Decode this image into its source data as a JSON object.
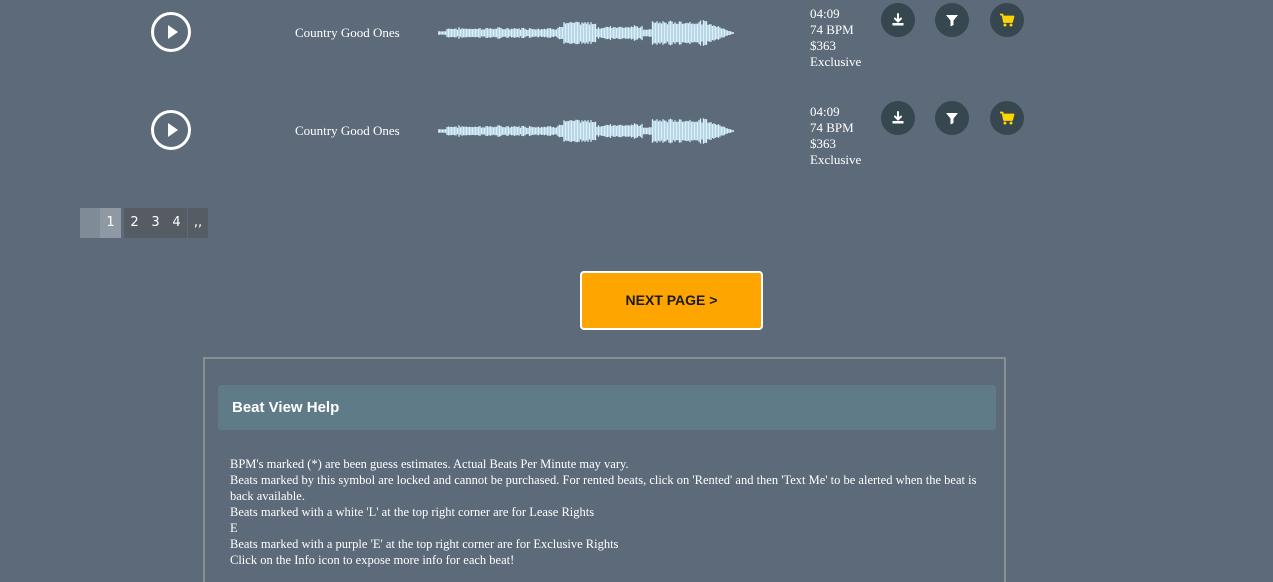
{
  "beats": [
    {
      "title": "Country Good Ones",
      "duration": "04:09",
      "bpm": "74 BPM",
      "price": "$363",
      "license": "Exclusive"
    },
    {
      "title": "Country Good Ones",
      "duration": "04:09",
      "bpm": "74 BPM",
      "price": "$363",
      "license": "Exclusive"
    }
  ],
  "icons": {
    "play": "play-icon",
    "download": "download-icon",
    "filter": "filter-icon",
    "cart": "cart-icon"
  },
  "colors": {
    "background": "#5c6a7a",
    "button_dark": "#36474f",
    "cart_yellow": "#ffd400",
    "waveform": "#d6f1ff",
    "next_page_orange": "#ffa500",
    "help_header": "#5f7b87"
  },
  "pagination": {
    "pages": [
      "1",
      "2",
      "3",
      "4",
      ",,"
    ],
    "current": "1"
  },
  "next_page_label": "NEXT PAGE >",
  "help": {
    "title": "Beat View Help",
    "lines": [
      "BPM's marked (*) are been guess estimates. Actual Beats Per Minute may vary.",
      "Beats marked by this symbol are locked and cannot be purchased. For rented beats, click on 'Rented' and then 'Text Me' to be alerted when the beat is back available.",
      "Beats marked with a white 'L' at the top right corner are for Lease Rights",
      "E",
      "Beats marked with a purple 'E' at the top right corner are for Exclusive Rights",
      "Click on the Info icon to expose more info for each beat!"
    ]
  }
}
